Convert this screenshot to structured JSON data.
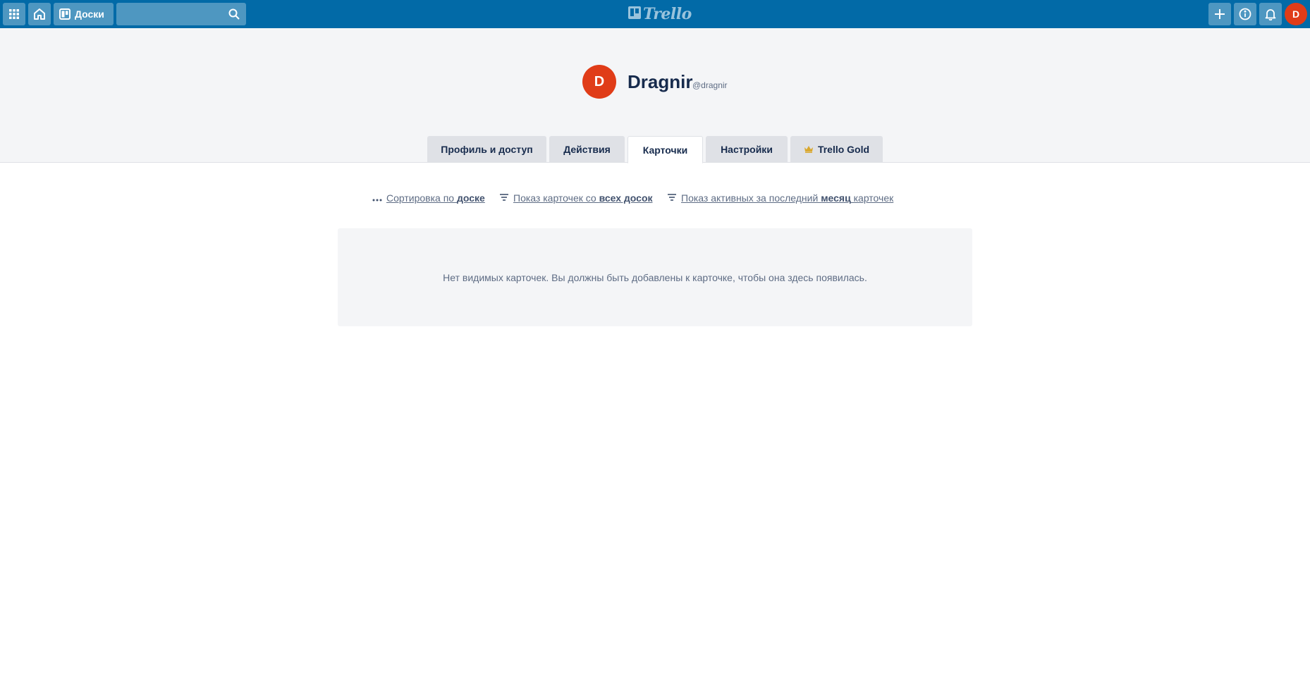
{
  "header": {
    "boards_label": "Доски",
    "search_placeholder": "",
    "logo_text": "Trello",
    "avatar_letter": "D"
  },
  "profile": {
    "avatar_letter": "D",
    "full_name": "Dragnir",
    "username": "@dragnir"
  },
  "tabs": [
    {
      "label": "Профиль и доступ",
      "active": false
    },
    {
      "label": "Действия",
      "active": false
    },
    {
      "label": "Карточки",
      "active": true
    },
    {
      "label": "Настройки",
      "active": false
    },
    {
      "label": "Trello Gold",
      "active": false
    }
  ],
  "filters": {
    "sort": {
      "prefix": "Сортировка по ",
      "bold": "доске"
    },
    "boards": {
      "prefix": "Показ карточек со ",
      "bold": "всех досок"
    },
    "activity": {
      "prefix": "Показ активных за последний ",
      "bold": "месяц",
      "suffix": " карточек"
    }
  },
  "empty_message": "Нет видимых карточек. Вы должны быть добавлены к карточке, чтобы она здесь появилась.",
  "colors": {
    "header_bg": "#026aa7",
    "avatar_bg": "#e03c18",
    "band_bg": "#f4f5f7"
  }
}
